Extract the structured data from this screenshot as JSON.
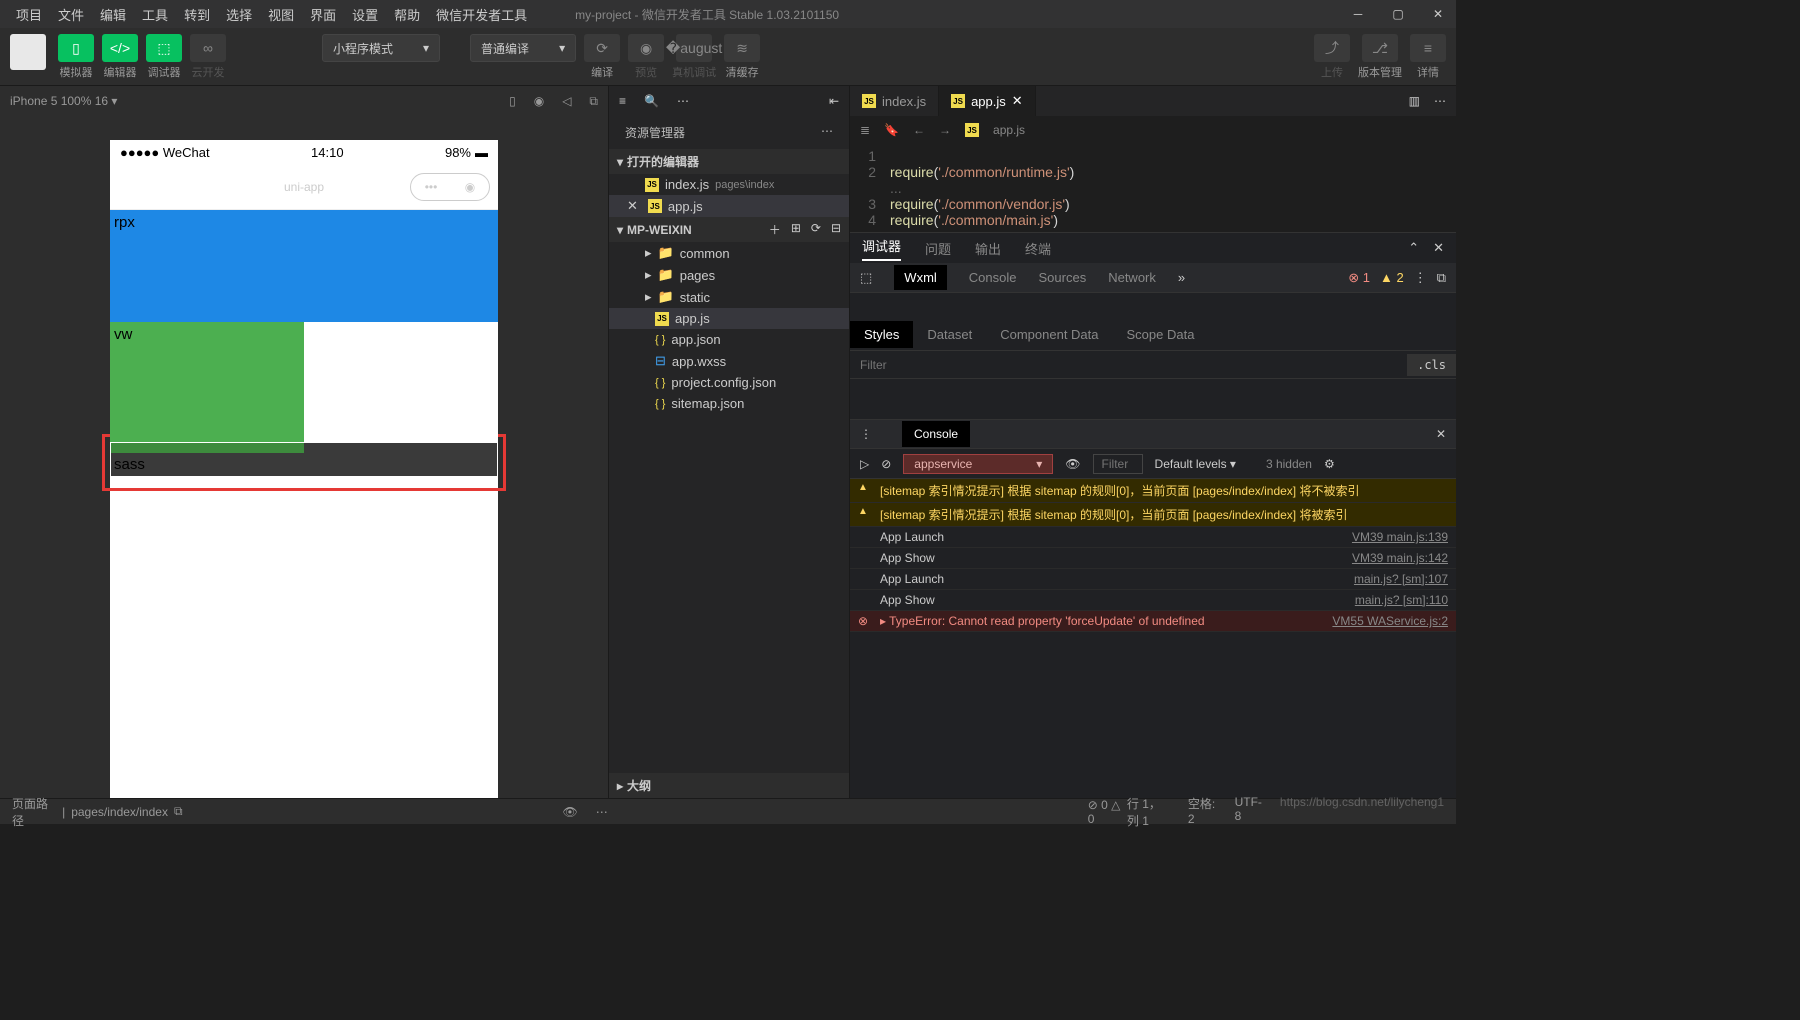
{
  "menus": [
    "项目",
    "文件",
    "编辑",
    "工具",
    "转到",
    "选择",
    "视图",
    "界面",
    "设置",
    "帮助",
    "微信开发者工具"
  ],
  "app_title": "my-project - 微信开发者工具 Stable 1.03.2101150",
  "toolbar": {
    "simulator": "模拟器",
    "editor": "编辑器",
    "debugger": "调试器",
    "cloud": "云开发",
    "mode": "小程序模式",
    "compile_mode": "普通编译",
    "compile": "编译",
    "preview": "预览",
    "remote": "真机调试",
    "clear": "清缓存",
    "upload": "上传",
    "version": "版本管理",
    "detail": "详情"
  },
  "sim": {
    "device": "iPhone 5 100% 16 ▾",
    "status_carrier": "●●●●● WeChat",
    "status_time": "14:10",
    "status_batt": "98%",
    "nav_title": "uni-app",
    "rpx": "rpx",
    "vw": "vw",
    "sass": "sass"
  },
  "explorer": {
    "title": "资源管理器",
    "opened": "打开的编辑器",
    "open_files": [
      {
        "name": "index.js",
        "hint": "pages\\index"
      },
      {
        "name": "app.js",
        "hint": ""
      }
    ],
    "project": "MP-WEIXIN",
    "tree": [
      {
        "name": "common",
        "type": "folder"
      },
      {
        "name": "pages",
        "type": "folder-o"
      },
      {
        "name": "static",
        "type": "folder-y"
      },
      {
        "name": "app.js",
        "type": "js"
      },
      {
        "name": "app.json",
        "type": "json"
      },
      {
        "name": "app.wxss",
        "type": "wxss"
      },
      {
        "name": "project.config.json",
        "type": "json"
      },
      {
        "name": "sitemap.json",
        "type": "json"
      }
    ],
    "outline": "大纲"
  },
  "editor": {
    "tabs": [
      {
        "name": "index.js",
        "active": false
      },
      {
        "name": "app.js",
        "active": true
      }
    ],
    "breadcrumb": "app.js",
    "lines": [
      {
        "n": "1",
        "code": ""
      },
      {
        "n": "2",
        "code": "require('./common/runtime.js')"
      },
      {
        "n": "",
        "code": "..."
      },
      {
        "n": "3",
        "code": "require('./common/vendor.js')"
      },
      {
        "n": "4",
        "code": "require('./common/main.js')"
      }
    ]
  },
  "debugger": {
    "tabs": [
      "调试器",
      "问题",
      "输出",
      "终端"
    ],
    "devtools": [
      "Wxml",
      "Console",
      "Sources",
      "Network"
    ],
    "err_count": "1",
    "warn_count": "2",
    "styles_tabs": [
      "Styles",
      "Dataset",
      "Component Data",
      "Scope Data"
    ],
    "filter_ph": "Filter",
    "cls": ".cls",
    "console_label": "Console",
    "context": "appservice",
    "filter2_ph": "Filter",
    "levels": "Default levels ▾",
    "hidden": "3 hidden",
    "msgs": [
      {
        "t": "warn",
        "text": "[sitemap 索引情况提示] 根据 sitemap 的规则[0]，当前页面 [pages/index/index] 将不被索引",
        "src": ""
      },
      {
        "t": "warn",
        "text": "[sitemap 索引情况提示] 根据 sitemap 的规则[0]，当前页面 [pages/index/index] 将被索引",
        "src": ""
      },
      {
        "t": "info",
        "text": "App Launch",
        "src": "VM39 main.js:139"
      },
      {
        "t": "info",
        "text": "App Show",
        "src": "VM39 main.js:142"
      },
      {
        "t": "info",
        "text": "App Launch",
        "src": "main.js? [sm]:107"
      },
      {
        "t": "info",
        "text": "App Show",
        "src": "main.js? [sm]:110"
      },
      {
        "t": "err",
        "text": "▸ TypeError: Cannot read property 'forceUpdate' of undefined",
        "src": "VM55 WAService.js:2"
      }
    ]
  },
  "status": {
    "path_label": "页面路径",
    "path": "pages/index/index",
    "errs": "⊘ 0 △ 0",
    "pos": "行 1，列 1",
    "spaces": "空格: 2",
    "enc": "UTF-8",
    "watermark": "https://blog.csdn.net/lilycheng1"
  }
}
